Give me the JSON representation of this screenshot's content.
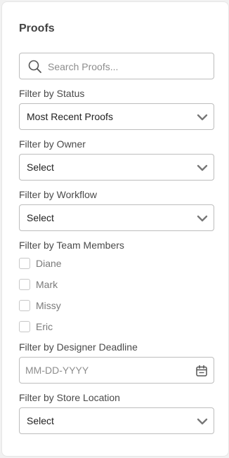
{
  "panel": {
    "title": "Proofs"
  },
  "search": {
    "placeholder": "Search Proofs..."
  },
  "filters": {
    "status": {
      "label": "Filter by Status",
      "value": "Most Recent Proofs"
    },
    "owner": {
      "label": "Filter by Owner",
      "value": "Select"
    },
    "workflow": {
      "label": "Filter by Workflow",
      "value": "Select"
    },
    "team": {
      "label": "Filter by Team Members",
      "members": [
        "Diane",
        "Mark",
        "Missy",
        "Eric"
      ]
    },
    "deadline": {
      "label": "Filter by Designer Deadline",
      "placeholder": "MM-DD-YYYY"
    },
    "store": {
      "label": "Filter by Store Location",
      "value": "Select"
    }
  },
  "icons": {
    "search": "search-icon",
    "chevron": "chevron-down-icon",
    "calendar": "calendar-icon"
  }
}
